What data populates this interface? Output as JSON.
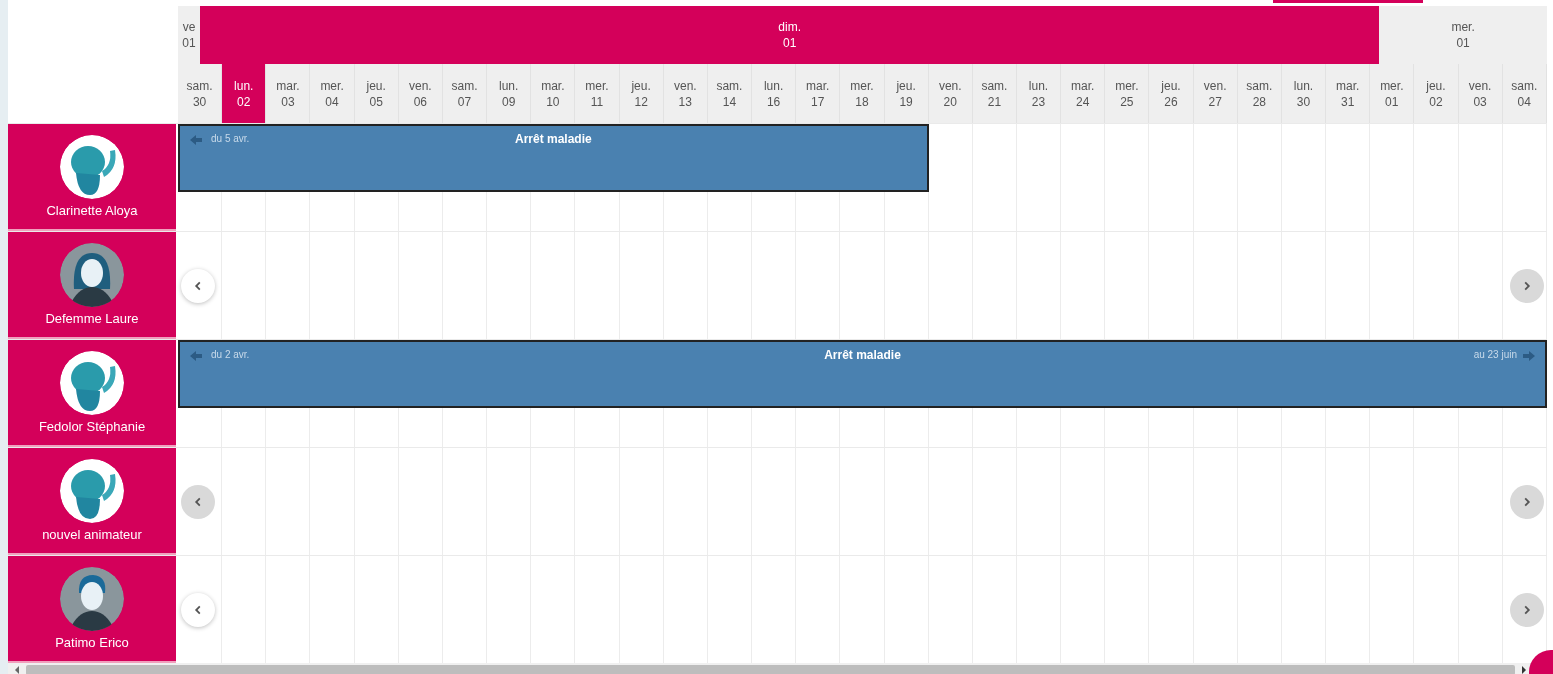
{
  "months": [
    {
      "day": "ve",
      "date": "01",
      "selected": false
    },
    {
      "day": "dim.",
      "date": "01",
      "selected": true
    },
    {
      "day": "mer.",
      "date": "01",
      "selected": false
    }
  ],
  "days": [
    {
      "day": "sam.",
      "date": "30",
      "selected": false
    },
    {
      "day": "lun.",
      "date": "02",
      "selected": true
    },
    {
      "day": "mar.",
      "date": "03",
      "selected": false
    },
    {
      "day": "mer.",
      "date": "04",
      "selected": false
    },
    {
      "day": "jeu.",
      "date": "05",
      "selected": false
    },
    {
      "day": "ven.",
      "date": "06",
      "selected": false
    },
    {
      "day": "sam.",
      "date": "07",
      "selected": false
    },
    {
      "day": "lun.",
      "date": "09",
      "selected": false
    },
    {
      "day": "mar.",
      "date": "10",
      "selected": false
    },
    {
      "day": "mer.",
      "date": "11",
      "selected": false
    },
    {
      "day": "jeu.",
      "date": "12",
      "selected": false
    },
    {
      "day": "ven.",
      "date": "13",
      "selected": false
    },
    {
      "day": "sam.",
      "date": "14",
      "selected": false
    },
    {
      "day": "lun.",
      "date": "16",
      "selected": false
    },
    {
      "day": "mar.",
      "date": "17",
      "selected": false
    },
    {
      "day": "mer.",
      "date": "18",
      "selected": false
    },
    {
      "day": "jeu.",
      "date": "19",
      "selected": false
    },
    {
      "day": "ven.",
      "date": "20",
      "selected": false
    },
    {
      "day": "sam.",
      "date": "21",
      "selected": false
    },
    {
      "day": "lun.",
      "date": "23",
      "selected": false
    },
    {
      "day": "mar.",
      "date": "24",
      "selected": false
    },
    {
      "day": "mer.",
      "date": "25",
      "selected": false
    },
    {
      "day": "jeu.",
      "date": "26",
      "selected": false
    },
    {
      "day": "ven.",
      "date": "27",
      "selected": false
    },
    {
      "day": "sam.",
      "date": "28",
      "selected": false
    },
    {
      "day": "lun.",
      "date": "30",
      "selected": false
    },
    {
      "day": "mar.",
      "date": "31",
      "selected": false
    },
    {
      "day": "mer.",
      "date": "01",
      "selected": false
    },
    {
      "day": "jeu.",
      "date": "02",
      "selected": false
    },
    {
      "day": "ven.",
      "date": "03",
      "selected": false
    },
    {
      "day": "sam.",
      "date": "04",
      "selected": false
    }
  ],
  "people": [
    {
      "name": "Clarinette Aloya",
      "avatar": {
        "kind": "mascot"
      },
      "event": {
        "title": "Arrêt maladie",
        "start_note": "du 5 avr.",
        "continues_after": false
      }
    },
    {
      "name": "Defemme Laure",
      "avatar": {
        "kind": "woman"
      },
      "nav": {
        "prev_enabled": true,
        "next_enabled": false
      }
    },
    {
      "name": "Fedolor Stéphanie",
      "avatar": {
        "kind": "mascot"
      },
      "event": {
        "title": "Arrêt maladie",
        "start_note": "du 2 avr.",
        "end_note": "au 23 juin",
        "continues_after": true
      }
    },
    {
      "name": "nouvel animateur",
      "avatar": {
        "kind": "mascot"
      },
      "nav": {
        "prev_enabled": false,
        "next_enabled": false
      }
    },
    {
      "name": "Patimo Erico",
      "avatar": {
        "kind": "man"
      },
      "nav": {
        "prev_enabled": true,
        "next_enabled": false
      }
    }
  ]
}
